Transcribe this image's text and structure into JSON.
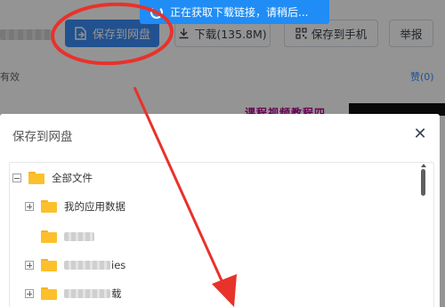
{
  "topbar": {
    "save_to_cloud_label": "保存到网盘",
    "download_label": "下载(135.8M)",
    "save_to_phone_label": "保存到手机",
    "report_label": "举报"
  },
  "info_row": {
    "validity_label": "有效",
    "like_label": "赞(0)"
  },
  "promo": {
    "text": "课程视频教程四"
  },
  "toast": {
    "message": "正在获取下载链接，请稍后..."
  },
  "dialog": {
    "title": "保存到网盘",
    "close_icon": "close-icon",
    "tree": {
      "root": {
        "label": "全部文件",
        "expanded": true
      },
      "children": [
        {
          "label": "我的应用数据",
          "has_children": true,
          "expanded": false
        },
        {
          "label": "",
          "has_children": false,
          "blurred": true
        },
        {
          "label": "ies",
          "has_children": true,
          "expanded": false,
          "blurred_prefix": true
        },
        {
          "label": "载",
          "has_children": true,
          "expanded": false,
          "blurred_prefix": true
        }
      ]
    }
  },
  "colors": {
    "accent": "#3b8cf6",
    "toast_bg": "#1f8df5",
    "annotation": "#e8322b",
    "folder": "#fcc02c"
  }
}
